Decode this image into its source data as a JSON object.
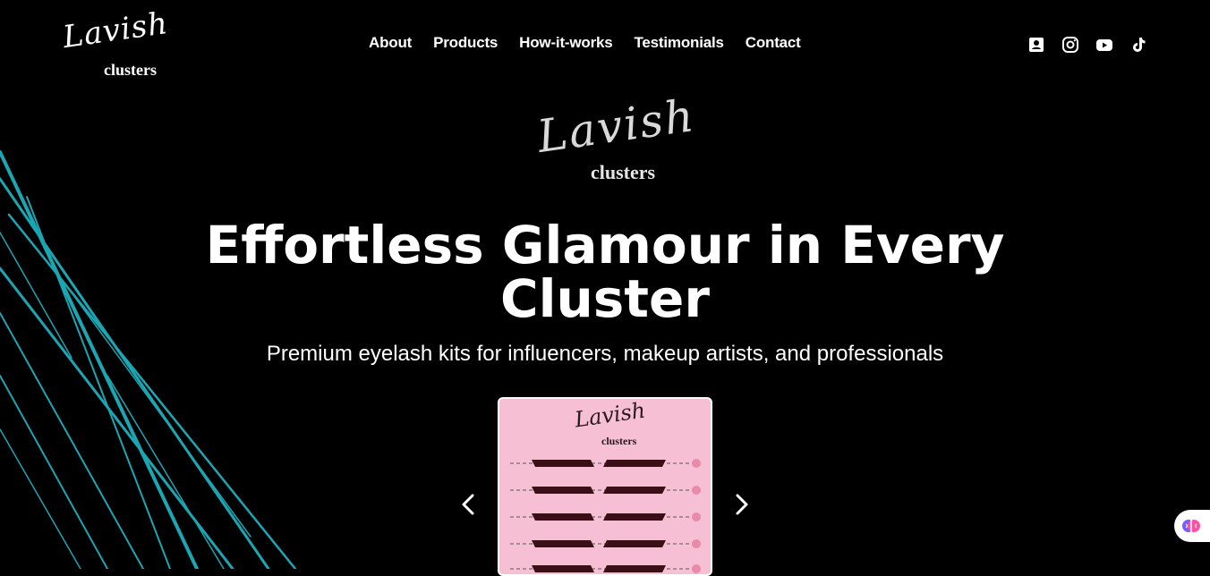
{
  "header": {
    "logo_script": "Lavish",
    "logo_sub": "clusters",
    "nav": [
      {
        "label": "About"
      },
      {
        "label": "Products"
      },
      {
        "label": "How-it-works"
      },
      {
        "label": "Testimonials"
      },
      {
        "label": "Contact"
      }
    ],
    "socials": [
      "contact-card-icon",
      "instagram-icon",
      "youtube-icon",
      "tiktok-icon"
    ]
  },
  "hero": {
    "logo_script": "Lavish",
    "logo_sub": "clusters",
    "title": "Effortless Glamour in Every Cluster",
    "subtitle": "Premium eyelash kits for influencers, makeup artists, and professionals"
  },
  "carousel": {
    "card_logo_script": "Lavish",
    "card_logo_sub": "clusters",
    "prev_icon": "chevron-left-icon",
    "next_icon": "chevron-right-icon"
  },
  "colors": {
    "background": "#000000",
    "accent_lines": "#1fb8c8",
    "card_pink": "#f6bfd3"
  }
}
